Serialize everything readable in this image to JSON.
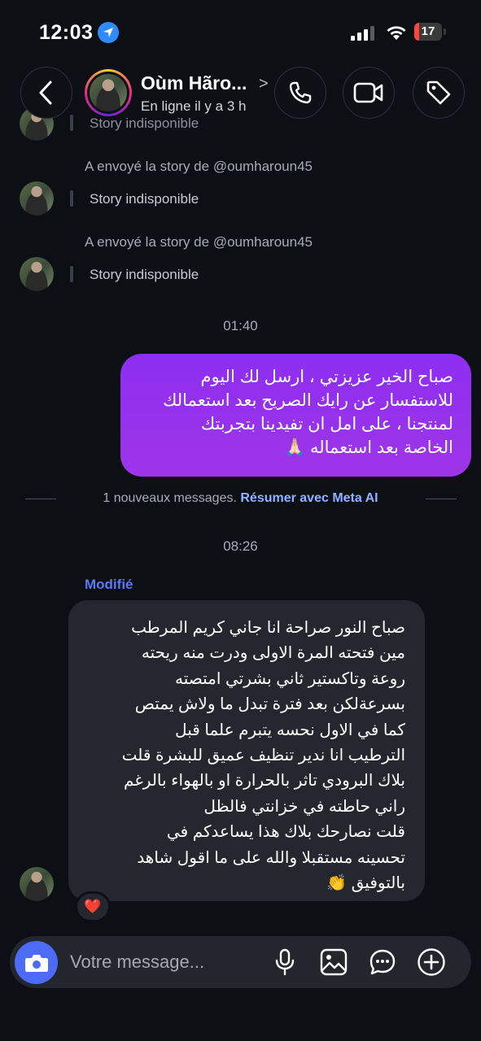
{
  "status_bar": {
    "time": "12:03",
    "battery": "17",
    "battery_level": 0.17
  },
  "header": {
    "contact_name": "Oùm Hãro...",
    "chevron": ">",
    "status": "En ligne il y a 3 h"
  },
  "ghost_story": {
    "text": "Story indisponible"
  },
  "story_rows": [
    {
      "sent_label": "A envoyé la story de @oumharoun45",
      "story_text": "Story indisponible"
    },
    {
      "sent_label": "A envoyé la story de @oumharoun45",
      "story_text": "Story indisponible"
    }
  ],
  "timestamps": {
    "first": "01:40",
    "second": "08:26"
  },
  "outgoing_message": {
    "lines": [
      "صباح الخير عزيزتي ، ارسل لك اليوم",
      "للاستفسار عن رايك الصريح بعد استعمالك",
      "لمنتجنا ، على امل ان تفيدينا بتجربتك",
      "الخاصة بعد استعماله 🙏🏻"
    ]
  },
  "new_messages": {
    "count_text": "1 nouveaux messages.",
    "action": "Résumer avec Meta AI"
  },
  "incoming_message": {
    "edited_label": "Modifié",
    "lines": [
      "صباح النور صراحة انا جاني كريم المرطب",
      "مين فتحته المرة الاولى ودرت منه ريحته",
      "روعة وتاكستير ثاني بشرتي امتصته",
      "بسرعةلكن بعد فترة تبدل ما ولاش يمتص",
      "كما في الاول نحسه يتبرم علما قبل",
      "الترطيب انا ندير تنظيف عميق للبشرة  قلت",
      "بلاك البرودي تاثر بالحرارة او بالهواء بالرغم",
      "راني حاطته في خزانتي فالظل",
      "قلت نصارحك بلاك هذا يساعدكم في",
      "تحسينه مستقبلا والله على ما اقول شاهد",
      "بالتوفيق 👏"
    ],
    "reaction": "❤️"
  },
  "composer": {
    "placeholder": "Votre message..."
  },
  "icons": {
    "back": "chevron-left-icon",
    "call": "phone-icon",
    "video": "video-camera-icon",
    "tag": "tag-icon",
    "camera": "camera-icon",
    "mic": "microphone-icon",
    "gallery": "image-icon",
    "sticker": "chat-bubble-icon",
    "more": "plus-circle-icon"
  },
  "colors": {
    "outgoing_bubble": "#9433ee",
    "incoming_bubble": "#24272d",
    "accent": "#4c6cf7",
    "edited": "#5b78f5",
    "meta_link": "#8fb3ff"
  }
}
